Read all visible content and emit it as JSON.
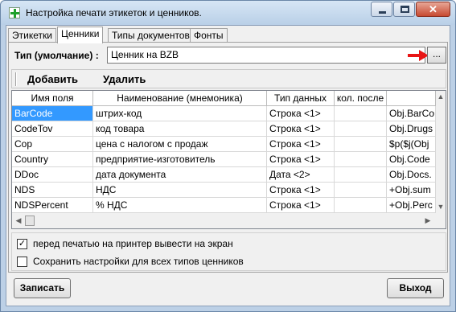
{
  "window": {
    "title": "Настройка печати этикеток и ценников."
  },
  "title_buttons": {
    "close_glyph": "✕"
  },
  "tabs": [
    {
      "label": "Этикетки"
    },
    {
      "label": "Ценники"
    },
    {
      "label": "Типы документов"
    },
    {
      "label": "Фонты"
    }
  ],
  "type_row": {
    "label": "Тип (умолчание) :",
    "value": "Ценник на BZB",
    "button": "..."
  },
  "toolbar": {
    "add": "Добавить",
    "delete": "Удалить"
  },
  "grid": {
    "columns": [
      "Имя поля",
      "Наименование (мнемоника)",
      "Тип данных",
      "кол. после",
      ""
    ],
    "rows": [
      [
        "BarCode",
        "штрих-код",
        "Строка <1>",
        "",
        "Obj.BarCo"
      ],
      [
        "CodeTov",
        "код товара",
        "Строка <1>",
        "",
        "Obj.Drugs"
      ],
      [
        "Cop",
        "цена с налогом с продаж",
        "Строка <1>",
        "",
        "$p($j(Obj"
      ],
      [
        "Country",
        "предприятие-изготовитель",
        "Строка <1>",
        "",
        "Obj.Code"
      ],
      [
        "DDoc",
        "дата документа",
        "Дата <2>",
        "",
        "Obj.Docs."
      ],
      [
        "NDS",
        "НДС",
        "Строка <1>",
        "",
        "+Obj.sum"
      ],
      [
        "NDSPercent",
        "% НДС",
        "Строка <1>",
        "",
        "+Obj.Perc"
      ]
    ],
    "selected_row": 0
  },
  "options": [
    {
      "label": "перед печатью на принтер вывести на экран",
      "checked": true
    },
    {
      "label": "Сохранить настройки для всех типов ценников",
      "checked": false
    }
  ],
  "footer": {
    "save": "Записать",
    "exit": "Выход"
  },
  "checkbox_glyph": "✓",
  "colors": {
    "selection": "#3399ff",
    "arrow": "#e81515",
    "app_icon_cross": "#1fa02c",
    "close_button": "#c74a31"
  },
  "icons": {
    "app": "green-cross-icon",
    "annotation": "red-arrow-icon"
  }
}
